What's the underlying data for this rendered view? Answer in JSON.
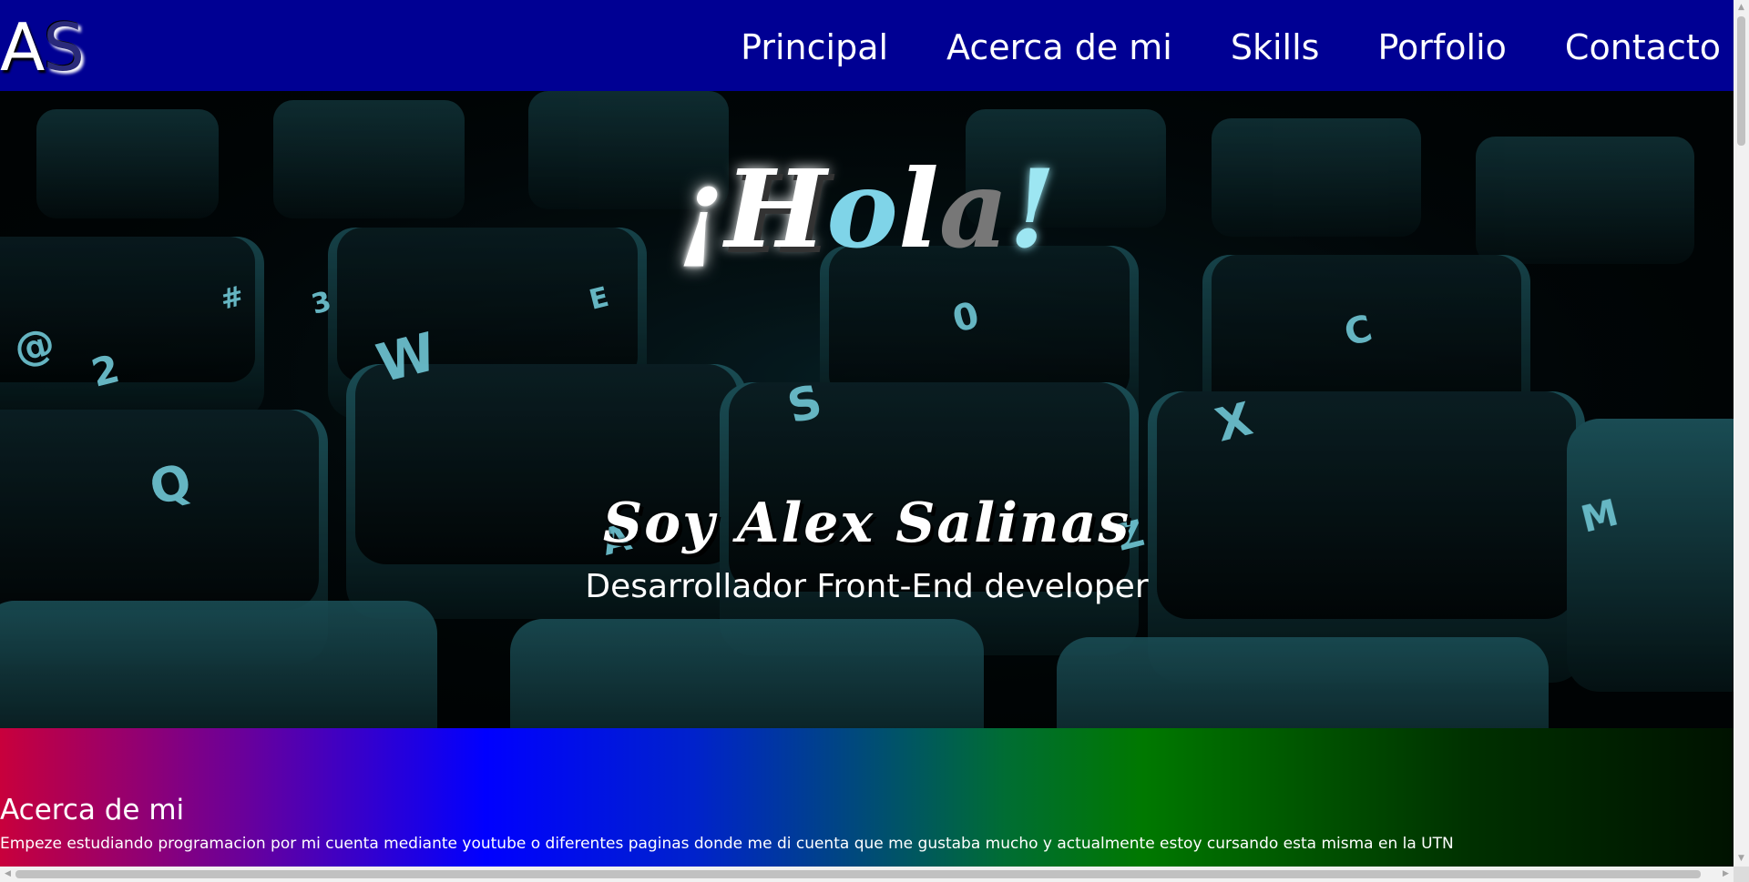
{
  "header": {
    "logo": {
      "first": "A",
      "second": "S"
    },
    "nav": [
      {
        "label": "Principal"
      },
      {
        "label": "Acerca de mi"
      },
      {
        "label": "Skills"
      },
      {
        "label": "Porfolio"
      },
      {
        "label": "Contacto"
      }
    ]
  },
  "hero": {
    "greeting": [
      "¡",
      "H",
      "o",
      "l",
      "a",
      "!"
    ],
    "name": "Soy Alex Salinas",
    "subtitle": "Desarrollador Front-End developer",
    "background": "keyboard-photo"
  },
  "about": {
    "title": "Acerca de mi",
    "text": "Empeze estudiando programacion por mi cuenta mediante youtube o diferentes paginas donde me di cuenta que me gustaba mucho y actualmente estoy cursando esta misma en la UTN"
  },
  "colors": {
    "navbar": "#000093",
    "hola_accent": "#7fd4e8",
    "about_gradient": [
      "#c8003c",
      "#0000ff",
      "#007800",
      "#001200"
    ]
  },
  "icons": {
    "scroll_up": "▲",
    "scroll_down": "▼",
    "scroll_left": "◀",
    "scroll_right": "▶"
  }
}
